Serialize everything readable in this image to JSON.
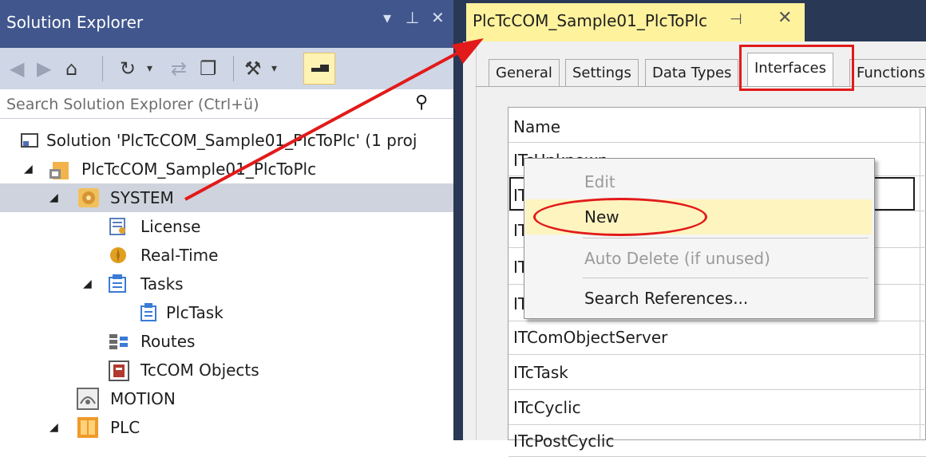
{
  "solution_explorer": {
    "title": "Solution Explorer",
    "title_buttons": [
      "▾",
      "⊥",
      "✕"
    ],
    "search_placeholder": "Search Solution Explorer (Ctrl+ü)",
    "tree": [
      {
        "label": "Solution 'PlcTcCOM_Sample01_PlcToPlc' (1 proj",
        "icon": "solution-icon",
        "expander": ""
      },
      {
        "label": "PlcTcCOM_Sample01_PlcToPlc",
        "icon": "project-icon",
        "expander": "◢"
      },
      {
        "label": "SYSTEM",
        "icon": "system-icon",
        "expander": "◢",
        "selected": true
      },
      {
        "label": "License",
        "icon": "license-icon",
        "expander": ""
      },
      {
        "label": "Real-Time",
        "icon": "realtime-icon",
        "expander": ""
      },
      {
        "label": "Tasks",
        "icon": "tasks-icon",
        "expander": "◢"
      },
      {
        "label": "PlcTask",
        "icon": "task-icon",
        "expander": ""
      },
      {
        "label": "Routes",
        "icon": "routes-icon",
        "expander": ""
      },
      {
        "label": "TcCOM Objects",
        "icon": "tccom-objects-icon",
        "expander": ""
      },
      {
        "label": "MOTION",
        "icon": "motion-icon",
        "expander": ""
      },
      {
        "label": "PLC",
        "icon": "plc-icon",
        "expander": "◢"
      }
    ]
  },
  "document": {
    "tab_title": "PlcTcCOM_Sample01_PlcToPlc",
    "tab_pin": "⊣",
    "tab_close": "✕",
    "inner_tabs": [
      "General",
      "Settings",
      "Data Types",
      "Interfaces",
      "Functions"
    ],
    "active_inner_tab": "Interfaces",
    "grid_header": "Name",
    "grid_rows": [
      "ITcUnknown",
      "IT",
      "IT",
      "IT",
      "IT",
      "ITComObjectServer",
      "ITcTask",
      "ITcCyclic",
      "ITcPostCyclic"
    ]
  },
  "context_menu": {
    "items": [
      {
        "label": "Edit",
        "enabled": false
      },
      {
        "label": "New",
        "enabled": true,
        "highlighted": true
      },
      {
        "label": "Auto Delete (if unused)",
        "enabled": false
      },
      {
        "label": "Search References...",
        "enabled": true
      }
    ]
  },
  "colors": {
    "annotation_red": "#e21a1a",
    "title_bar": "#40568d",
    "doc_tab": "#fff29d"
  }
}
